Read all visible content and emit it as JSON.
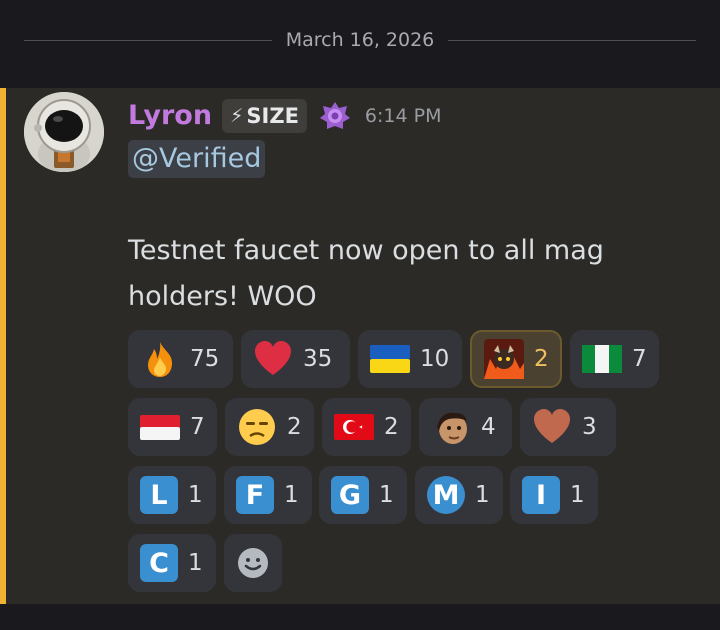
{
  "date_divider": "March 16, 2026",
  "message": {
    "username": "Lyron",
    "tag": "SIZE",
    "timestamp": "6:14 PM",
    "mention": "@Verified",
    "text": "Testnet faucet now open to all mag holders! WOO",
    "accent_color": "#f0b232",
    "username_color": "#c27ade"
  },
  "reactions": [
    {
      "emoji": "fire-emoji",
      "count": "75"
    },
    {
      "emoji": "red-heart-emoji",
      "count": "35"
    },
    {
      "emoji": "flag-ukraine-emoji",
      "count": "10"
    },
    {
      "emoji": "custom-demon-emoji",
      "count": "2",
      "active": true
    },
    {
      "emoji": "flag-nigeria-emoji",
      "count": "7"
    },
    {
      "emoji": "flag-indonesia-emoji",
      "count": "7"
    },
    {
      "emoji": "unamused-face-emoji",
      "count": "2"
    },
    {
      "emoji": "flag-turkey-emoji",
      "count": "2"
    },
    {
      "emoji": "custom-face-emoji",
      "count": "4"
    },
    {
      "emoji": "brown-heart-emoji",
      "count": "3"
    },
    {
      "emoji": "letter-l-emoji",
      "letter": "L",
      "count": "1"
    },
    {
      "emoji": "letter-f-emoji",
      "letter": "F",
      "count": "1"
    },
    {
      "emoji": "letter-g-emoji",
      "letter": "G",
      "count": "1"
    },
    {
      "emoji": "letter-m-emoji",
      "letter": "M",
      "count": "1"
    },
    {
      "emoji": "letter-i-emoji",
      "letter": "I",
      "count": "1"
    },
    {
      "emoji": "letter-c-emoji",
      "letter": "C",
      "count": "1"
    }
  ]
}
